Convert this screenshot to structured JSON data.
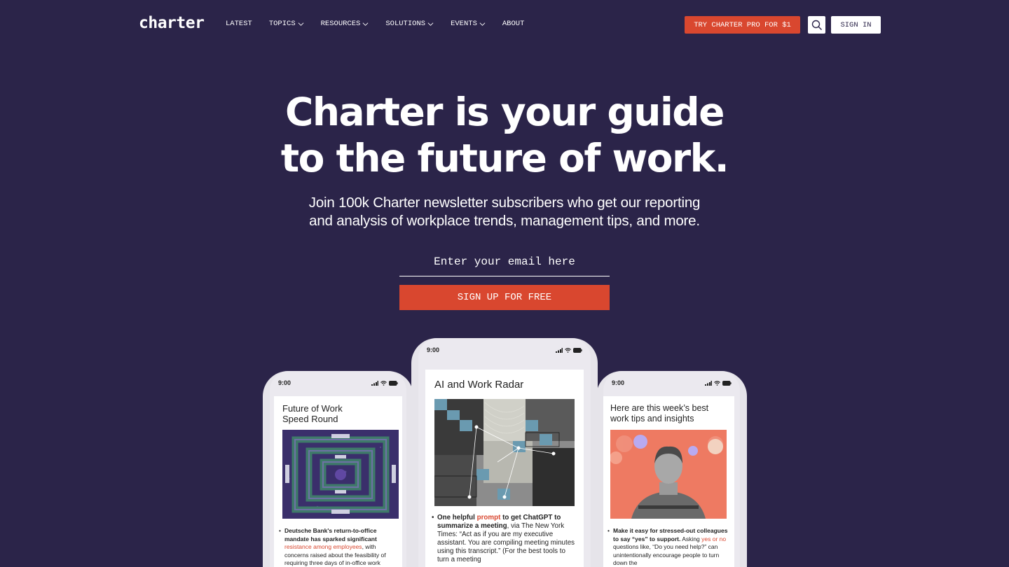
{
  "header": {
    "logo": "charter",
    "nav": [
      {
        "label": "LATEST",
        "dropdown": false
      },
      {
        "label": "TOPICS",
        "dropdown": true
      },
      {
        "label": "RESOURCES",
        "dropdown": true
      },
      {
        "label": "SOLUTIONS",
        "dropdown": true
      },
      {
        "label": "EVENTS",
        "dropdown": true
      },
      {
        "label": "ABOUT",
        "dropdown": false
      }
    ],
    "pro_button": "TRY CHARTER PRO FOR $1",
    "signin_button": "SIGN IN"
  },
  "hero": {
    "title_line1": "Charter is your guide",
    "title_line2": "to the future of work.",
    "subtitle_line1": "Join 100k Charter newsletter subscribers who get our reporting",
    "subtitle_line2": "and analysis of workplace trends, management tips, and more.",
    "email_placeholder": "Enter your email here",
    "signup_button": "SIGN UP FOR FREE"
  },
  "phones": [
    {
      "time": "9:00",
      "title_line1": "Future of Work",
      "title_line2": "Speed Round",
      "bullet_bold": "Deutsche Bank's return-to-office mandate has sparked significant",
      "bullet_link": "resistance among employees",
      "bullet_rest": ", with concerns raised about the feasibility of requiring three days of in-office work"
    },
    {
      "time": "9:00",
      "title": "AI and Work Radar",
      "bullet_bold1": "One helpful",
      "bullet_link": "prompt",
      "bullet_bold2": "to get ChatGPT to summarize a meeting",
      "bullet_rest": ", via The New York Times: “Act as if you are my executive assistant. You are compiling meeting minutes using this transcript.” (For the best tools to turn a meeting"
    },
    {
      "time": "9:00",
      "title_line1": "Here are this week’s best",
      "title_line2": "work tips and insights",
      "bullet_bold": "Make it easy for stressed-out colleagues to say “yes” to support.",
      "bullet_pre": "Asking",
      "bullet_link": "yes or no",
      "bullet_rest": "questions like, “Do you need help?” can unintentionally encourage people to turn down the"
    }
  ],
  "colors": {
    "background": "#2b2449",
    "accent": "#d9472f",
    "text": "#ffffff"
  },
  "icons": [
    "chevron-down-icon",
    "search-icon",
    "signal-icon",
    "wifi-icon",
    "battery-icon"
  ]
}
